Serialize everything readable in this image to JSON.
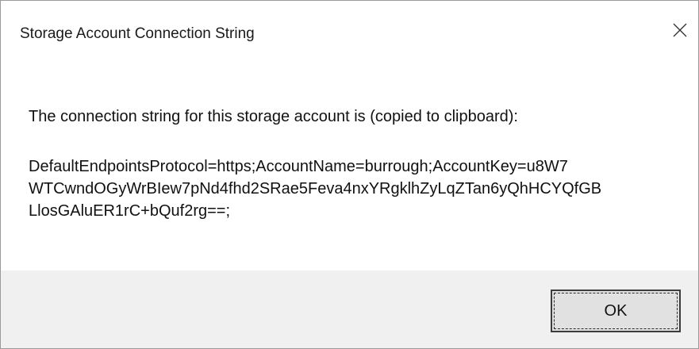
{
  "dialog": {
    "title": "Storage Account Connection String",
    "close_icon": "close-icon"
  },
  "content": {
    "message": "The connection string for this storage account is (copied to clipboard):",
    "connection_string_lines": [
      "DefaultEndpointsProtocol=https;AccountName=burrough;AccountKey=u8W7",
      "WTCwndOGyWrBIew7pNd4fhd2SRae5Feva4nxYRgklhZyLqZTan6yQhHCYQfGB",
      "LlosGAluER1rC+bQuf2rg==;"
    ]
  },
  "footer": {
    "ok_label": "OK"
  },
  "colors": {
    "footer_background": "#f0f0f0",
    "dialog_background": "#ffffff",
    "button_background": "#e1e1e1"
  }
}
